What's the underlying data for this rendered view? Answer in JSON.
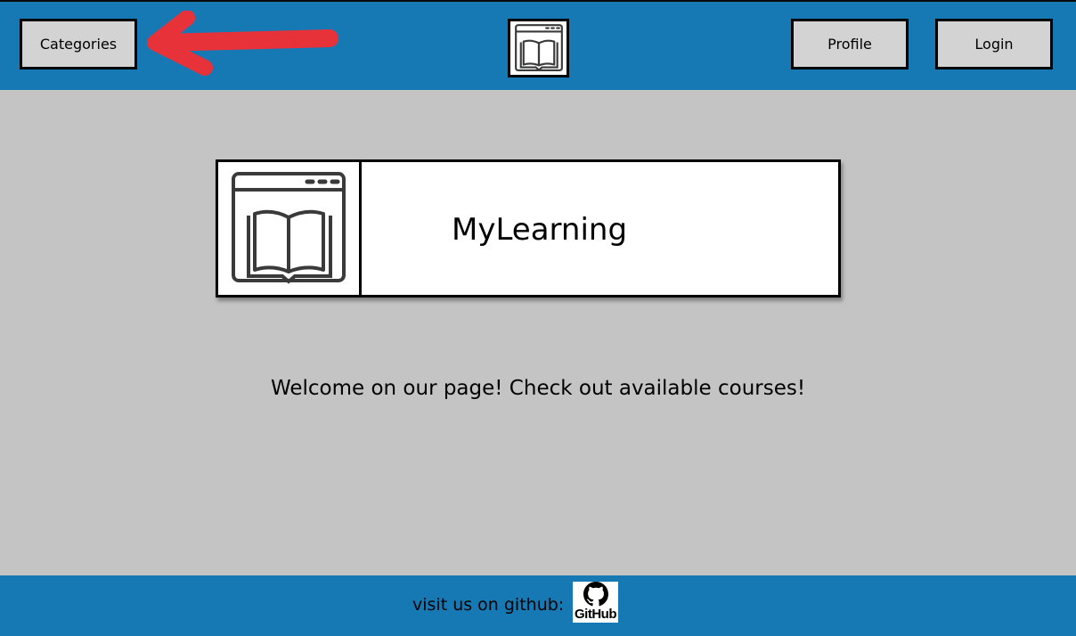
{
  "header": {
    "categories_label": "Categories",
    "profile_label": "Profile",
    "login_label": "Login",
    "logo_icon": "book-browser-icon"
  },
  "annotation": {
    "arrow_color": "#e8323a",
    "arrow_icon": "arrow-left-icon"
  },
  "main": {
    "card_icon": "book-browser-icon",
    "title": "MyLearning",
    "welcome_text": "Welcome on our page! Check out available courses!"
  },
  "footer": {
    "text": "visit us on github:",
    "github_logo_text": "GitHub",
    "github_icon": "github-icon"
  },
  "colors": {
    "header_bg": "#1679b4",
    "page_bg": "#c4c4c4",
    "button_bg": "#d3d3d3"
  }
}
